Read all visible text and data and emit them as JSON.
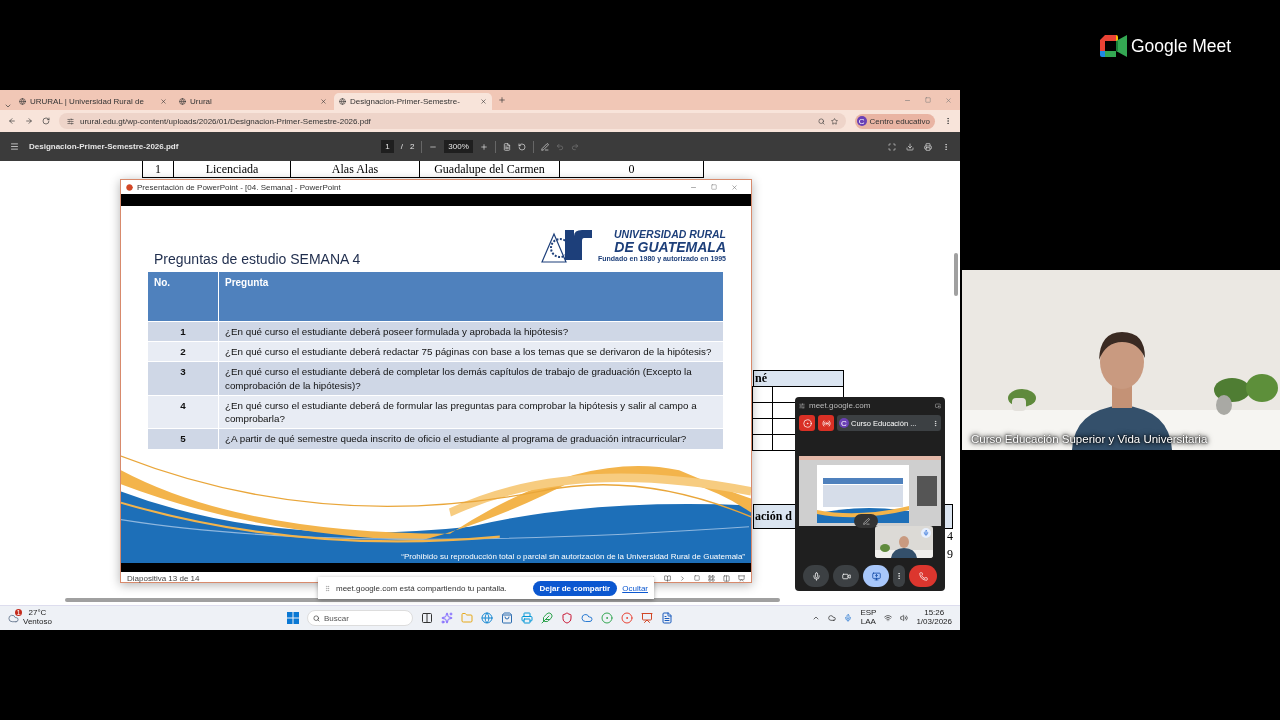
{
  "browser": {
    "tabs": [
      {
        "title": "URURAL | Universidad Rural de",
        "selected": false
      },
      {
        "title": "Urural",
        "selected": false
      },
      {
        "title": "Designacion-Primer-Semestre-",
        "selected": true
      }
    ],
    "address": "urural.edu.gt/wp-content/uploads/2026/01/Designacion-Primer-Semestre-2026.pdf",
    "profile": {
      "initial": "C",
      "name": "Centro educativo"
    }
  },
  "pdf": {
    "filename": "Designacion-Primer-Semestre-2026.pdf",
    "page": "1",
    "separator": "/",
    "pages": "2",
    "zoom": "300%",
    "top_row": [
      "1",
      "Licenciada",
      "Alas Alas",
      "Guadalupe del Carmen",
      "0"
    ],
    "fragments": {
      "header_1": "né",
      "header_2": "ación d",
      "cell_1": "4",
      "cell_2": "9"
    }
  },
  "powerpoint": {
    "title": "Presentación de PowerPoint - [04. Semana] - PowerPoint",
    "status": "Diapositiva 13 de 14",
    "slide": {
      "logo": {
        "line_1": "UNIVERSIDAD RURAL",
        "line_2": "DE GUATEMALA",
        "tagline": "Fundado en 1980 y autorizado en 1995"
      },
      "title": "Preguntas de estudio SEMANA 4",
      "columns": [
        "No.",
        "Pregunta"
      ],
      "rows": [
        {
          "no": "1",
          "question": "¿En qué curso el estudiante deberá poseer formulada y aprobada la hipótesis?"
        },
        {
          "no": "2",
          "question": "¿En qué curso el estudiante deberá redactar 75 páginas con base a los temas que se derivaron de la hipótesis?"
        },
        {
          "no": "3",
          "question": "¿En qué curso el estudiante deberá de completar los demás capítulos de trabajo de graduación (Excepto la comprobación de la hipótesis)?"
        },
        {
          "no": "4",
          "question": "¿En qué curso el estudiante deberá de formular las preguntas para comprobar la hipótesis y salir al campo a comprobarla?"
        },
        {
          "no": "5",
          "question": "¿A partir de qué semestre queda inscrito de oficio el estudiante al programa de graduación intracurricular?"
        }
      ],
      "footer": "“Prohibido su reproducción total o parcial sin autorización de la Universidad Rural de Guatemala”"
    }
  },
  "share_bar": {
    "message": "meet.google.com está compartiendo tu pantalla.",
    "stop": "Dejar de compartir",
    "hide": "Ocultar"
  },
  "meet_popup": {
    "url": "meet.google.com",
    "meeting": {
      "initial": "C",
      "name": "Curso Educación ..."
    }
  },
  "taskbar": {
    "weather": {
      "badge": "1",
      "temp": "27°C",
      "condition": "Ventoso"
    },
    "search": {
      "placeholder": "Buscar"
    },
    "language": [
      "ESP",
      "LAA"
    ],
    "time": "15:26",
    "date": "1/03/2026"
  },
  "meet": {
    "brand": "Google Meet",
    "tile": {
      "caption": "Curso Educación Superior y Vida Universitaria"
    }
  }
}
